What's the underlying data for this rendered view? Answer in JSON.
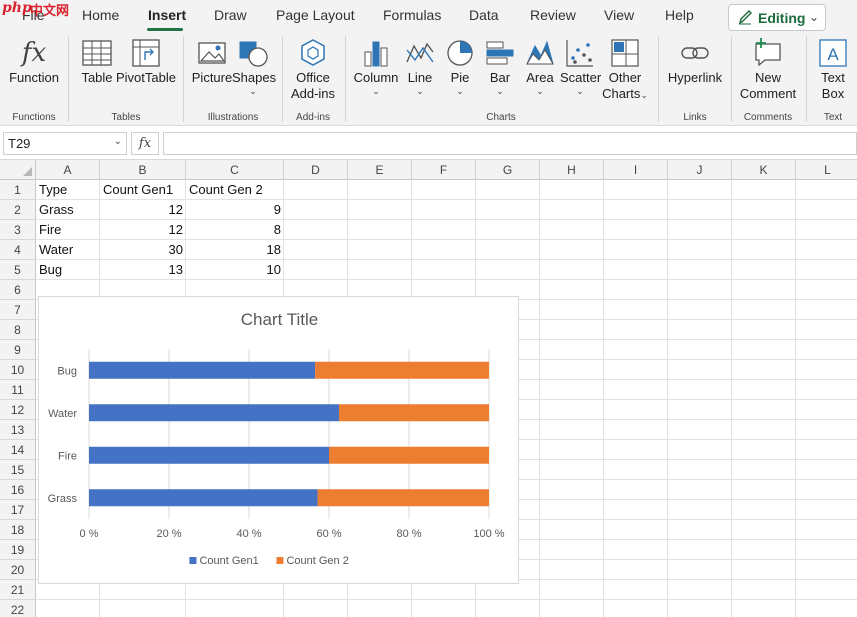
{
  "logo": {
    "text_php": "php",
    "text_cn": "中文网"
  },
  "tabs": [
    {
      "label": "File"
    },
    {
      "label": "Home"
    },
    {
      "label": "Insert"
    },
    {
      "label": "Draw"
    },
    {
      "label": "Page Layout"
    },
    {
      "label": "Formulas"
    },
    {
      "label": "Data"
    },
    {
      "label": "Review"
    },
    {
      "label": "View"
    },
    {
      "label": "Help"
    }
  ],
  "editing": {
    "label": "Editing",
    "chevron": "⌄"
  },
  "ribbon": {
    "function": {
      "label": "Function"
    },
    "table": {
      "label": "Table"
    },
    "pivottable": {
      "label": "PivotTable"
    },
    "picture": {
      "label": "Picture"
    },
    "shapes": {
      "label": "Shapes"
    },
    "office_addins": {
      "line1": "Office",
      "line2": "Add-ins"
    },
    "column": {
      "label": "Column"
    },
    "line": {
      "label": "Line"
    },
    "pie": {
      "label": "Pie"
    },
    "bar": {
      "label": "Bar"
    },
    "area": {
      "label": "Area"
    },
    "scatter": {
      "label": "Scatter"
    },
    "other_charts": {
      "line1": "Other",
      "line2": "Charts"
    },
    "hyperlink": {
      "label": "Hyperlink"
    },
    "new_comment": {
      "line1": "New",
      "line2": "Comment"
    },
    "text_box": {
      "line1": "Text",
      "line2": "Box"
    },
    "caret": "⌄",
    "groups": {
      "functions": "Functions",
      "tables": "Tables",
      "illustrations": "Illustrations",
      "addins": "Add-ins",
      "charts": "Charts",
      "links": "Links",
      "comments": "Comments",
      "text": "Text"
    }
  },
  "formula_bar": {
    "name_box": "T29",
    "fx": "fx",
    "value": ""
  },
  "columns": [
    "A",
    "B",
    "C",
    "D",
    "E",
    "F",
    "G",
    "H",
    "I",
    "J",
    "K",
    "L"
  ],
  "rows": [
    "1",
    "2",
    "3",
    "4",
    "5",
    "6",
    "7",
    "8",
    "9",
    "10",
    "11",
    "12",
    "13",
    "14",
    "15",
    "16",
    "17",
    "18",
    "19",
    "20",
    "21",
    "22"
  ],
  "sheet": {
    "header": [
      "Type",
      "Count Gen1",
      "Count Gen 2"
    ],
    "data": [
      [
        "Grass",
        "12",
        "9"
      ],
      [
        "Fire",
        "12",
        "8"
      ],
      [
        "Water",
        "30",
        "18"
      ],
      [
        "Bug",
        "13",
        "10"
      ]
    ]
  },
  "chart_data": {
    "type": "bar",
    "orientation": "horizontal",
    "stacked": "100%",
    "title": "Chart Title",
    "categories": [
      "Grass",
      "Fire",
      "Water",
      "Bug"
    ],
    "series": [
      {
        "name": "Count Gen1",
        "values": [
          12,
          12,
          30,
          13
        ],
        "color": "#4472c4"
      },
      {
        "name": "Count Gen 2",
        "values": [
          9,
          8,
          18,
          10
        ],
        "color": "#ed7d31"
      }
    ],
    "x_ticks": [
      "0 %",
      "20 %",
      "40 %",
      "60 %",
      "80 %",
      "100 %"
    ],
    "xlim": [
      0,
      100
    ],
    "grid": true,
    "legend": "bottom"
  }
}
